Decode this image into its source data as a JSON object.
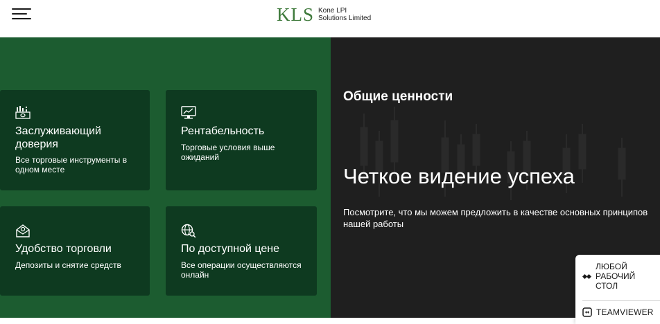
{
  "header": {
    "logo_mark": "KLS",
    "logo_line1": "Kone LPI",
    "logo_line2": "Solutions Limited"
  },
  "features": [
    {
      "icon": "trading-instruments-icon",
      "title": "Заслуживающий доверия",
      "desc": "Все торговые инструменты в одном месте"
    },
    {
      "icon": "chart-monitor-icon",
      "title": "Рентабельность",
      "desc": "Торговые условия выше ожиданий"
    },
    {
      "icon": "wallet-transfer-icon",
      "title": "Удобство торговли",
      "desc": "Депозиты и снятие средств"
    },
    {
      "icon": "globe-search-icon",
      "title": "По доступной цене",
      "desc": "Все операции осуществляются онлайн"
    }
  ],
  "values": {
    "kicker": "Общие ценности",
    "title": "Четкое видение успеха",
    "description": "Посмотрите, что мы можем предложить в качестве основных принципов нашей работы"
  },
  "remote_widget": {
    "line1": "ЛЮБОЙ",
    "line2": "РАБОЧИЙ",
    "line3": "СТОЛ",
    "teamviewer": "TEAMVIEWER"
  },
  "colors": {
    "green_panel": "#1c5c30",
    "card_bg": "#0e3a20",
    "dark_panel": "#1f1f1f",
    "logo_green": "#3f7a3c"
  }
}
